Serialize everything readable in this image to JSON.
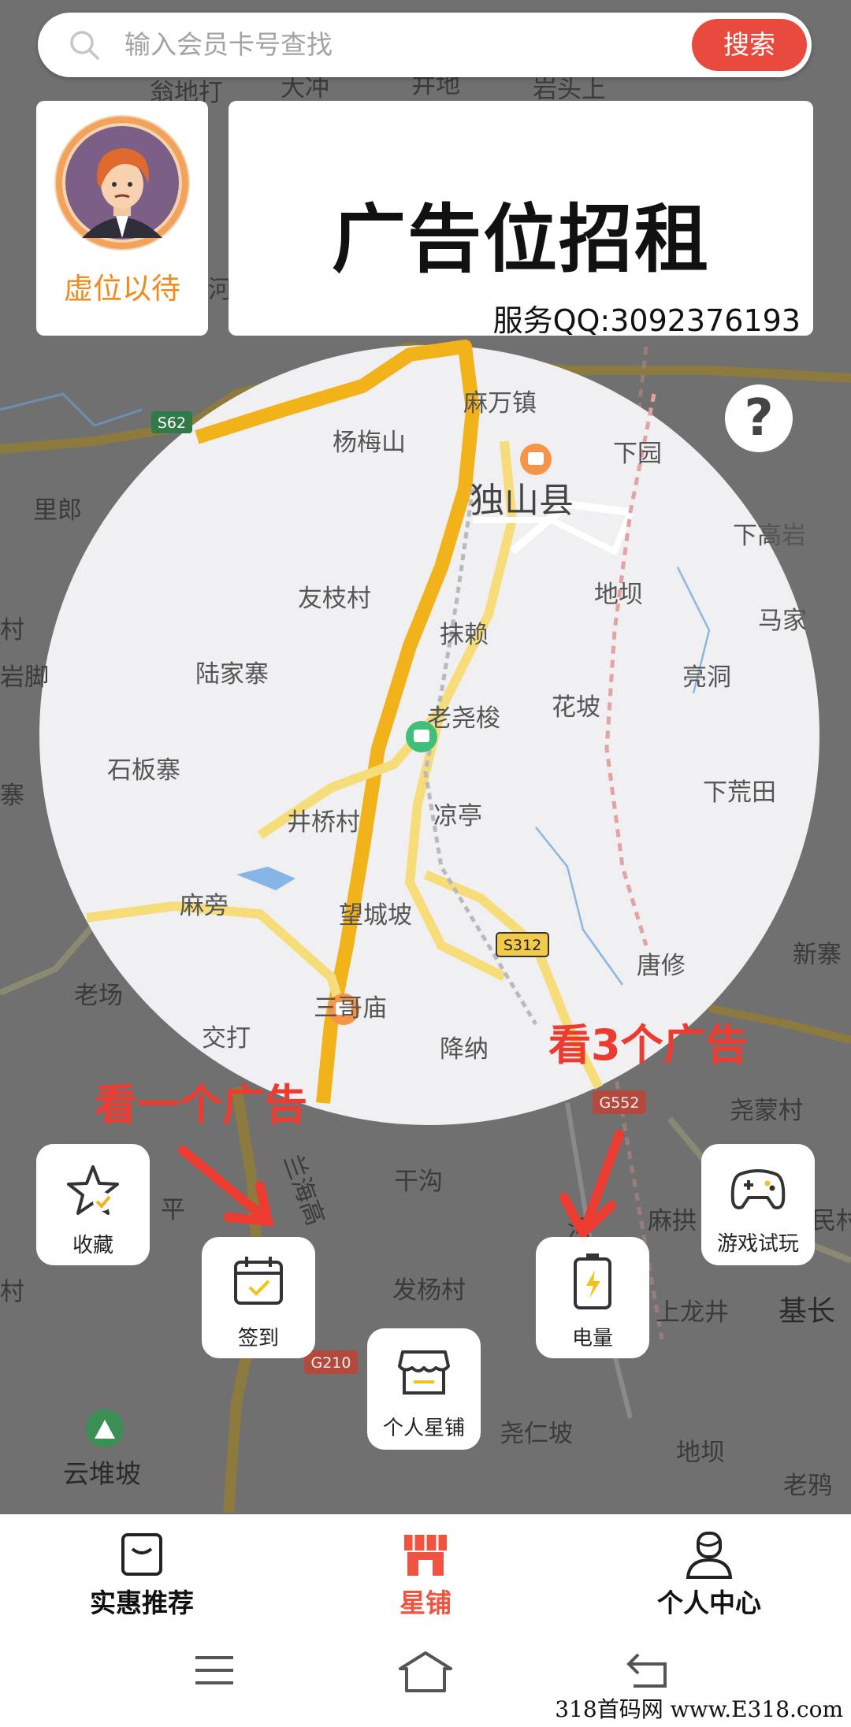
{
  "search": {
    "placeholder": "输入会员卡号查找",
    "button": "搜索"
  },
  "promo": {
    "avatar_label": "虚位以待",
    "ad_title": "广告位招租",
    "ad_contact": "服务QQ:3092376193"
  },
  "map": {
    "labels": {
      "l01": "麻万镇",
      "l02": "杨梅山",
      "l03": "下园",
      "l04": "独山县",
      "l05": "里郎",
      "l06": "下高岩",
      "l07": "友枝村",
      "l08": "地坝",
      "l09": "马家",
      "l10": "抹赖",
      "l11": "陆家寨",
      "l12": "亮洞",
      "l13": "花坡",
      "l14": "老尧梭",
      "l15": "石板寨",
      "l16": "下荒田",
      "l17": "井桥村",
      "l18": "凉亭",
      "l19": "麻旁",
      "l20": "望城坡",
      "l21": "唐修",
      "l22": "新寨",
      "l23": "老场",
      "l24": "三哥庙",
      "l25": "交打",
      "l26": "降纳",
      "l27": "尧蒙村",
      "l28": "干沟",
      "l29": "平",
      "l30": "麻拱",
      "l31": "民村",
      "l32": "发杨村",
      "l33": "上龙井",
      "l34": "基长",
      "l35": "尧仁坡",
      "l36": "地坝",
      "l37": "老鸦",
      "l38": "云堆坡",
      "l39": "村",
      "l40": "岩脚",
      "l41": "寨",
      "l42": "村",
      "l43": "翁地打",
      "l44": "大冲",
      "l45": "井地",
      "l46": "岩头上",
      "l47": "河",
      "l48": "河",
      "l49": "兰海高"
    },
    "road_shields": {
      "s62": "S62",
      "s312": "S312",
      "g552": "G552",
      "g210": "G210"
    }
  },
  "annotations": {
    "watch_one": "看一个广告",
    "watch_three": "看3个广告"
  },
  "actions": {
    "favorite": "收藏",
    "checkin": "签到",
    "power": "电量",
    "game_trial": "游戏试玩",
    "my_shop": "个人星铺"
  },
  "tabs": {
    "deals": "实惠推荐",
    "shop": "星铺",
    "profile": "个人中心",
    "active_color": "#f0533f"
  },
  "watermark": "318首码网 www.E318.com",
  "colors": {
    "accent": "#e84a3e",
    "avatar_label": "#f08a1c",
    "annotation_red": "#ec3b30"
  }
}
